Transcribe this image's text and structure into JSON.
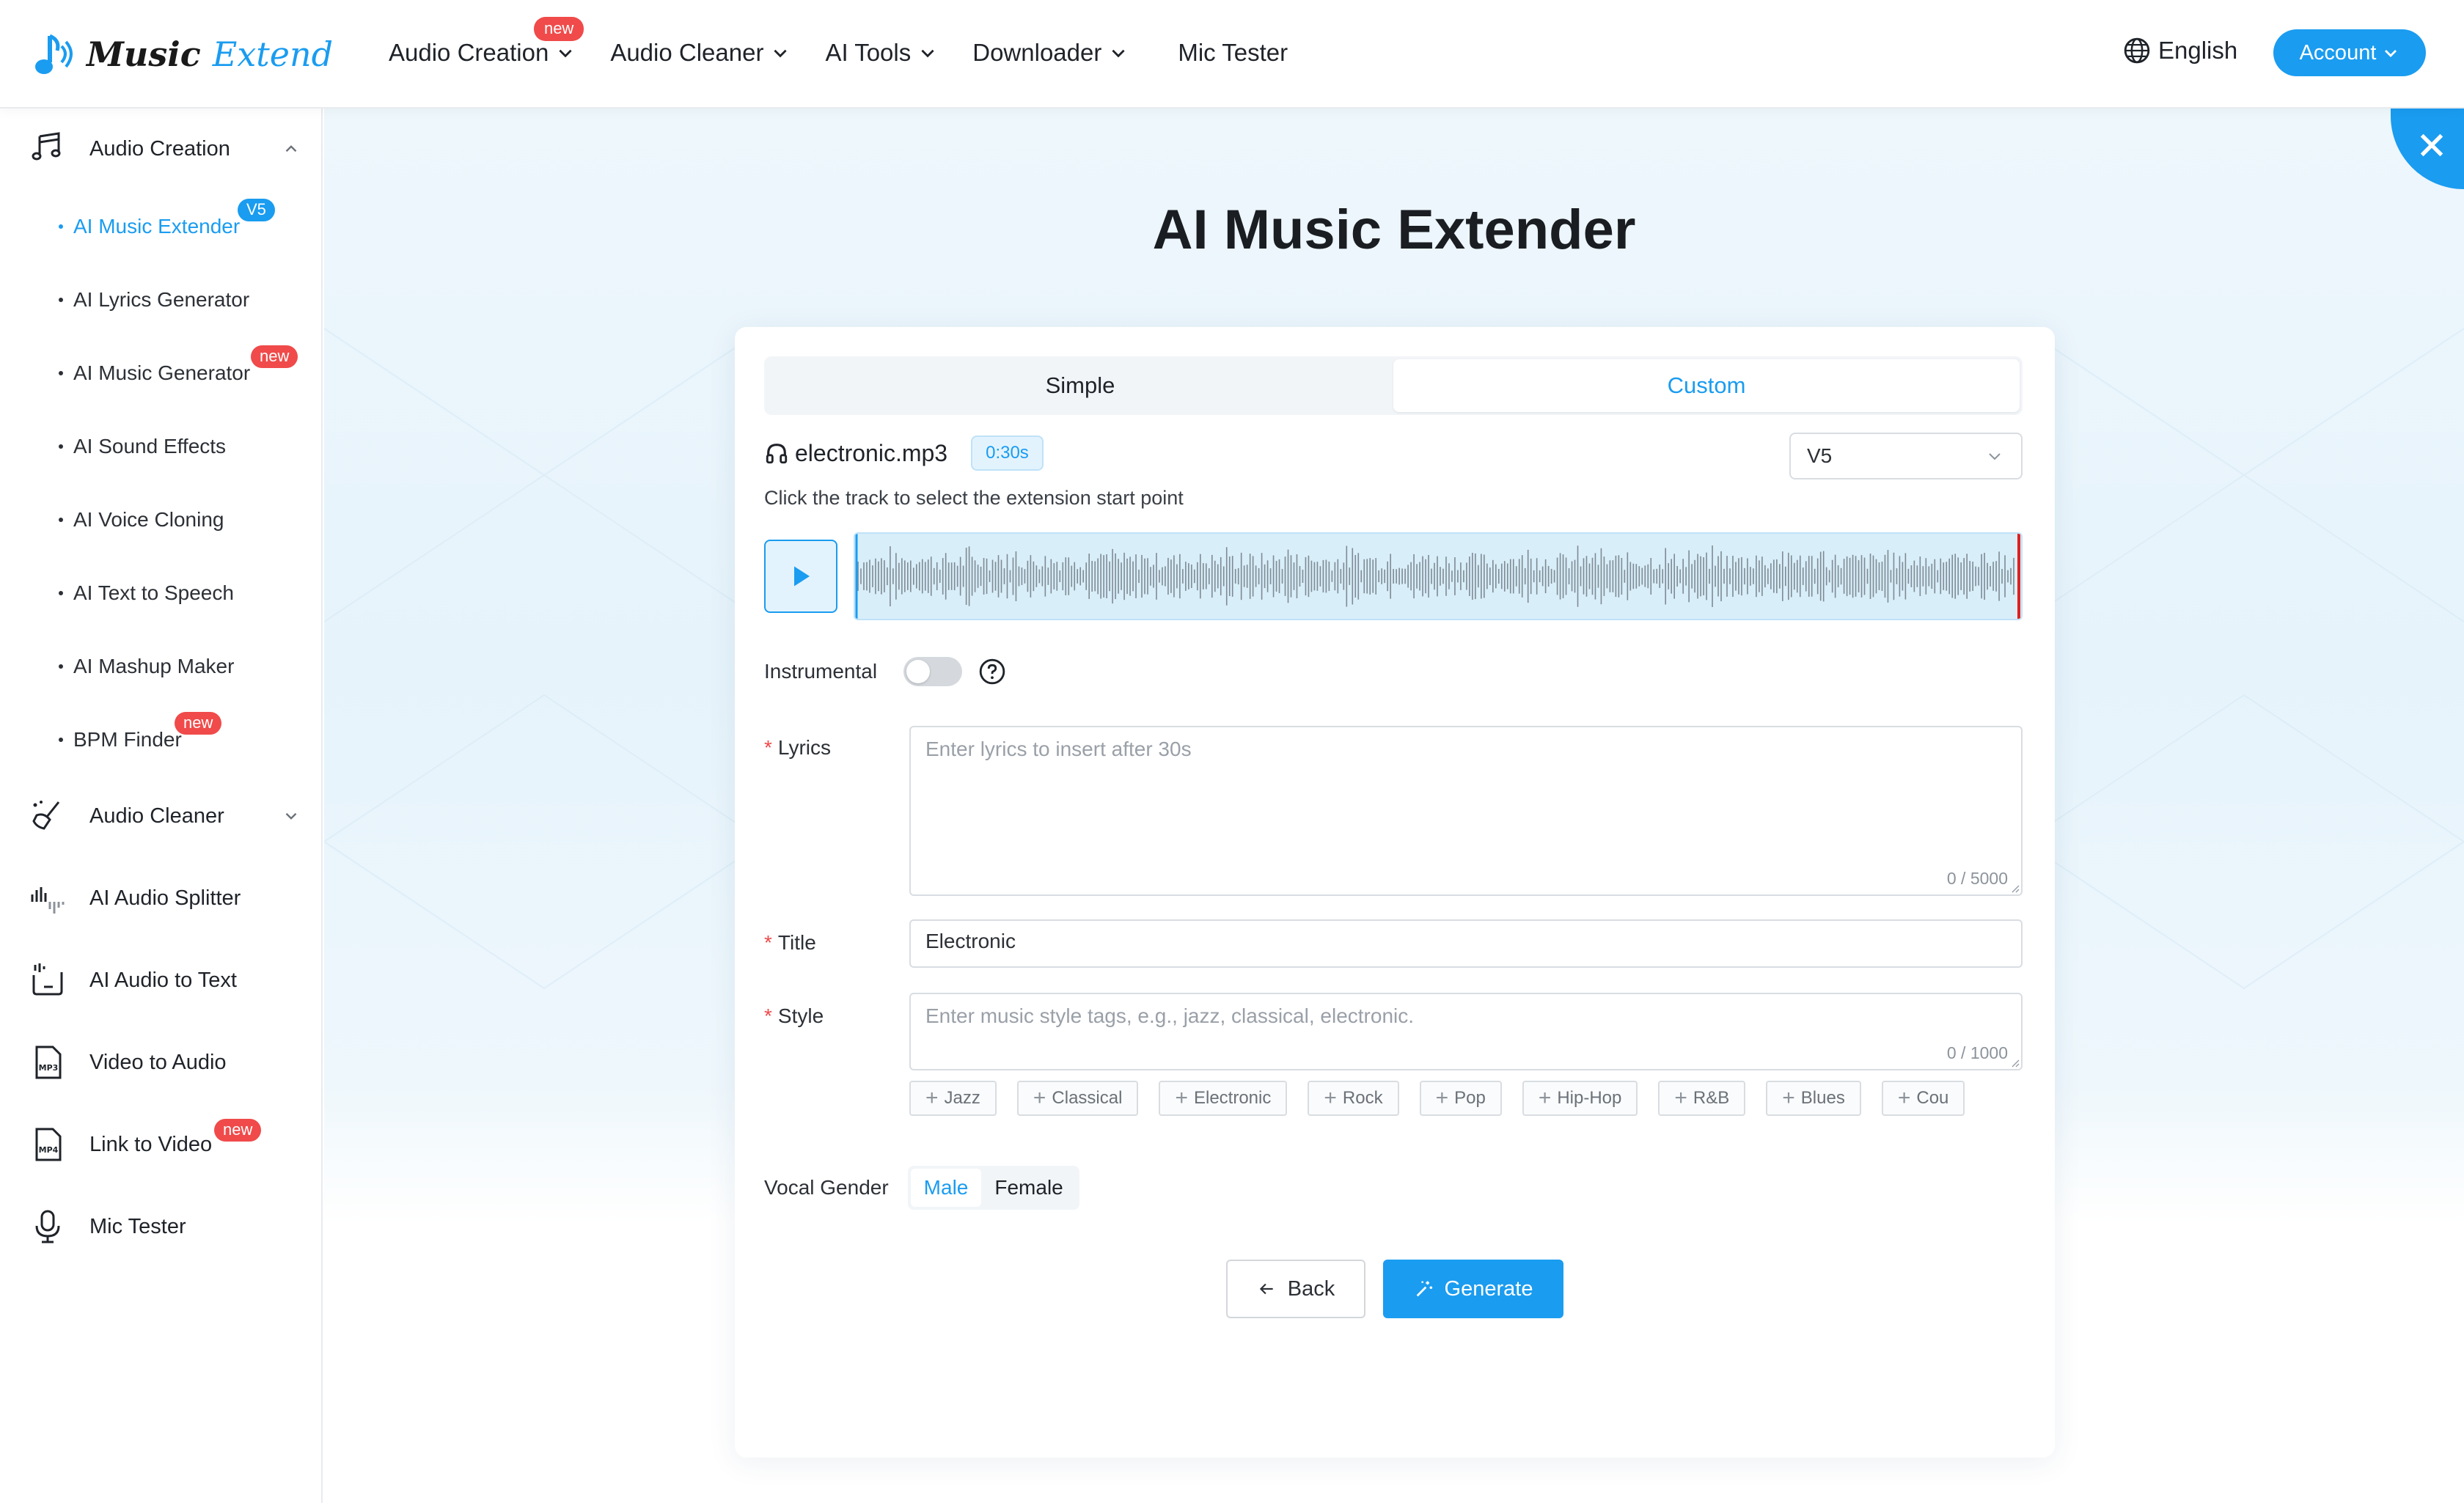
{
  "brand": {
    "name_part1": "Music",
    "name_part2": "Extend",
    "accent": "#1a9cf0",
    "badge_red": "#f04a4a"
  },
  "topnav": {
    "items": [
      {
        "label": "Audio Creation",
        "badge": "new",
        "has_dropdown": true
      },
      {
        "label": "Audio Cleaner",
        "has_dropdown": true
      },
      {
        "label": "AI Tools",
        "has_dropdown": true
      },
      {
        "label": "Downloader",
        "has_dropdown": true
      },
      {
        "label": "Mic Tester",
        "has_dropdown": false
      }
    ],
    "language": "English",
    "account_label": "Account"
  },
  "sidebar": {
    "audio_creation": {
      "label": "Audio Creation",
      "expanded": true,
      "items": [
        {
          "label": "AI Music Extender",
          "badge": "V5",
          "active": true
        },
        {
          "label": "AI Lyrics Generator"
        },
        {
          "label": "AI Music Generator",
          "badge": "new"
        },
        {
          "label": "AI Sound Effects"
        },
        {
          "label": "AI Voice Cloning"
        },
        {
          "label": "AI Text to Speech"
        },
        {
          "label": "AI Mashup Maker"
        },
        {
          "label": "BPM Finder",
          "badge": "new"
        }
      ]
    },
    "groups": [
      {
        "label": "Audio Cleaner",
        "icon": "broom-icon",
        "has_caret": true
      },
      {
        "label": "AI Audio Splitter",
        "icon": "waveform-split-icon"
      },
      {
        "label": "AI Audio to Text",
        "icon": "audio-text-icon"
      },
      {
        "label": "Video to Audio",
        "icon": "mp3-file-icon"
      },
      {
        "label": "Link to Video",
        "icon": "mp4-file-icon",
        "badge": "new"
      },
      {
        "label": "Mic Tester",
        "icon": "microphone-icon"
      }
    ]
  },
  "page": {
    "title": "AI Music Extender"
  },
  "form": {
    "tabs": [
      {
        "label": "Simple",
        "active": false
      },
      {
        "label": "Custom",
        "active": true
      }
    ],
    "file_name": "electronic.mp3",
    "duration_badge": "0:30s",
    "model_version": "V5",
    "hint": "Click the track to select the extension start point",
    "instrumental_label": "Instrumental",
    "instrumental_on": false,
    "lyrics": {
      "label": "Lyrics",
      "placeholder": "Enter lyrics to insert after 30s",
      "count": "0 / 5000"
    },
    "title": {
      "label": "Title",
      "value": "Electronic"
    },
    "style": {
      "label": "Style",
      "placeholder": "Enter music style tags, e.g., jazz, classical, electronic.",
      "count": "0 / 1000",
      "tags": [
        "Jazz",
        "Classical",
        "Electronic",
        "Rock",
        "Pop",
        "Hip-Hop",
        "R&B",
        "Blues",
        "Cou"
      ]
    },
    "vocal_gender": {
      "label": "Vocal Gender",
      "options": [
        "Male",
        "Female"
      ],
      "selected": "Male"
    },
    "back_label": "Back",
    "generate_label": "Generate"
  }
}
